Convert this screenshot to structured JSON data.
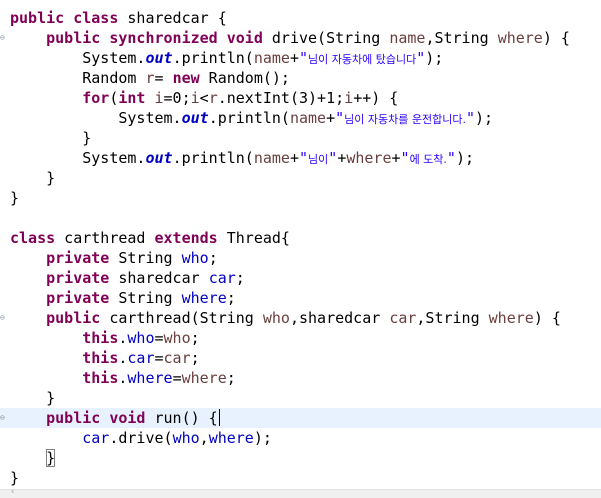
{
  "editor": {
    "lines": [
      {
        "parts": [
          {
            "t": "public",
            "c": "kw"
          },
          {
            "t": " "
          },
          {
            "t": "class",
            "c": "kw"
          },
          {
            "t": " sharedcar {"
          }
        ]
      },
      {
        "fold": true,
        "parts": [
          {
            "t": "    "
          },
          {
            "t": "public",
            "c": "kw"
          },
          {
            "t": " "
          },
          {
            "t": "synchronized",
            "c": "kw"
          },
          {
            "t": " "
          },
          {
            "t": "void",
            "c": "kw"
          },
          {
            "t": " drive(String "
          },
          {
            "t": "name",
            "c": "par"
          },
          {
            "t": ",String "
          },
          {
            "t": "where",
            "c": "par"
          },
          {
            "t": ") {"
          }
        ]
      },
      {
        "parts": [
          {
            "t": "        System."
          },
          {
            "t": "out",
            "c": "sfld"
          },
          {
            "t": ".println("
          },
          {
            "t": "name",
            "c": "par"
          },
          {
            "t": "+"
          },
          {
            "t": "\"",
            "c": "str"
          },
          {
            "t": "님이 자동차에 탔습니다",
            "c": "str ko"
          },
          {
            "t": "\"",
            "c": "str"
          },
          {
            "t": ");"
          }
        ]
      },
      {
        "parts": [
          {
            "t": "        Random "
          },
          {
            "t": "r",
            "c": "par"
          },
          {
            "t": "= "
          },
          {
            "t": "new",
            "c": "kw"
          },
          {
            "t": " Random();"
          }
        ]
      },
      {
        "parts": [
          {
            "t": "        "
          },
          {
            "t": "for",
            "c": "kw"
          },
          {
            "t": "("
          },
          {
            "t": "int",
            "c": "kw"
          },
          {
            "t": " "
          },
          {
            "t": "i",
            "c": "par"
          },
          {
            "t": "=0;"
          },
          {
            "t": "i",
            "c": "par"
          },
          {
            "t": "<"
          },
          {
            "t": "r",
            "c": "par"
          },
          {
            "t": ".nextInt(3)+1;"
          },
          {
            "t": "i",
            "c": "par"
          },
          {
            "t": "++) {"
          }
        ]
      },
      {
        "parts": [
          {
            "t": "            System."
          },
          {
            "t": "out",
            "c": "sfld"
          },
          {
            "t": ".println("
          },
          {
            "t": "name",
            "c": "par"
          },
          {
            "t": "+"
          },
          {
            "t": "\"",
            "c": "str"
          },
          {
            "t": "님이 자동차를 운전합니다.",
            "c": "str ko"
          },
          {
            "t": "\"",
            "c": "str"
          },
          {
            "t": ");"
          }
        ]
      },
      {
        "parts": [
          {
            "t": "        }"
          }
        ]
      },
      {
        "parts": [
          {
            "t": "        System."
          },
          {
            "t": "out",
            "c": "sfld"
          },
          {
            "t": ".println("
          },
          {
            "t": "name",
            "c": "par"
          },
          {
            "t": "+"
          },
          {
            "t": "\"",
            "c": "str"
          },
          {
            "t": "님이",
            "c": "str ko"
          },
          {
            "t": "\"",
            "c": "str"
          },
          {
            "t": "+"
          },
          {
            "t": "where",
            "c": "par"
          },
          {
            "t": "+"
          },
          {
            "t": "\"",
            "c": "str"
          },
          {
            "t": "에 도착.",
            "c": "str ko"
          },
          {
            "t": "\"",
            "c": "str"
          },
          {
            "t": ");"
          }
        ]
      },
      {
        "parts": [
          {
            "t": "    }"
          }
        ]
      },
      {
        "parts": [
          {
            "t": "}"
          }
        ]
      },
      {
        "parts": []
      },
      {
        "parts": [
          {
            "t": "class",
            "c": "kw"
          },
          {
            "t": " carthread "
          },
          {
            "t": "extends",
            "c": "kw"
          },
          {
            "t": " Thread{"
          }
        ]
      },
      {
        "parts": [
          {
            "t": "    "
          },
          {
            "t": "private",
            "c": "kw"
          },
          {
            "t": " String "
          },
          {
            "t": "who",
            "c": "fld"
          },
          {
            "t": ";"
          }
        ]
      },
      {
        "parts": [
          {
            "t": "    "
          },
          {
            "t": "private",
            "c": "kw"
          },
          {
            "t": " sharedcar "
          },
          {
            "t": "car",
            "c": "fld"
          },
          {
            "t": ";"
          }
        ]
      },
      {
        "parts": [
          {
            "t": "    "
          },
          {
            "t": "private",
            "c": "kw"
          },
          {
            "t": " String "
          },
          {
            "t": "where",
            "c": "fld"
          },
          {
            "t": ";"
          }
        ]
      },
      {
        "fold": true,
        "parts": [
          {
            "t": "    "
          },
          {
            "t": "public",
            "c": "kw"
          },
          {
            "t": " carthread(String "
          },
          {
            "t": "who",
            "c": "par"
          },
          {
            "t": ",sharedcar "
          },
          {
            "t": "car",
            "c": "par"
          },
          {
            "t": ",String "
          },
          {
            "t": "where",
            "c": "par"
          },
          {
            "t": ") {"
          }
        ]
      },
      {
        "parts": [
          {
            "t": "        "
          },
          {
            "t": "this",
            "c": "kw"
          },
          {
            "t": "."
          },
          {
            "t": "who",
            "c": "fld"
          },
          {
            "t": "="
          },
          {
            "t": "who",
            "c": "par"
          },
          {
            "t": ";"
          }
        ]
      },
      {
        "parts": [
          {
            "t": "        "
          },
          {
            "t": "this",
            "c": "kw"
          },
          {
            "t": "."
          },
          {
            "t": "car",
            "c": "fld"
          },
          {
            "t": "="
          },
          {
            "t": "car",
            "c": "par"
          },
          {
            "t": ";"
          }
        ]
      },
      {
        "parts": [
          {
            "t": "        "
          },
          {
            "t": "this",
            "c": "kw"
          },
          {
            "t": "."
          },
          {
            "t": "where",
            "c": "fld"
          },
          {
            "t": "="
          },
          {
            "t": "where",
            "c": "par"
          },
          {
            "t": ";"
          }
        ]
      },
      {
        "parts": [
          {
            "t": "    }"
          }
        ]
      },
      {
        "fold": true,
        "current": true,
        "caret": true,
        "parts": [
          {
            "t": "    "
          },
          {
            "t": "public",
            "c": "kw"
          },
          {
            "t": " "
          },
          {
            "t": "void",
            "c": "kw"
          },
          {
            "t": " run() {"
          }
        ]
      },
      {
        "parts": [
          {
            "t": "        "
          },
          {
            "t": "car",
            "c": "fld"
          },
          {
            "t": ".drive("
          },
          {
            "t": "who",
            "c": "fld"
          },
          {
            "t": ","
          },
          {
            "t": "where",
            "c": "fld"
          },
          {
            "t": ");"
          }
        ]
      },
      {
        "parts": [
          {
            "t": "    "
          },
          {
            "t": "}",
            "c": "brk"
          }
        ]
      },
      {
        "parts": [
          {
            "t": "}"
          }
        ]
      }
    ]
  }
}
